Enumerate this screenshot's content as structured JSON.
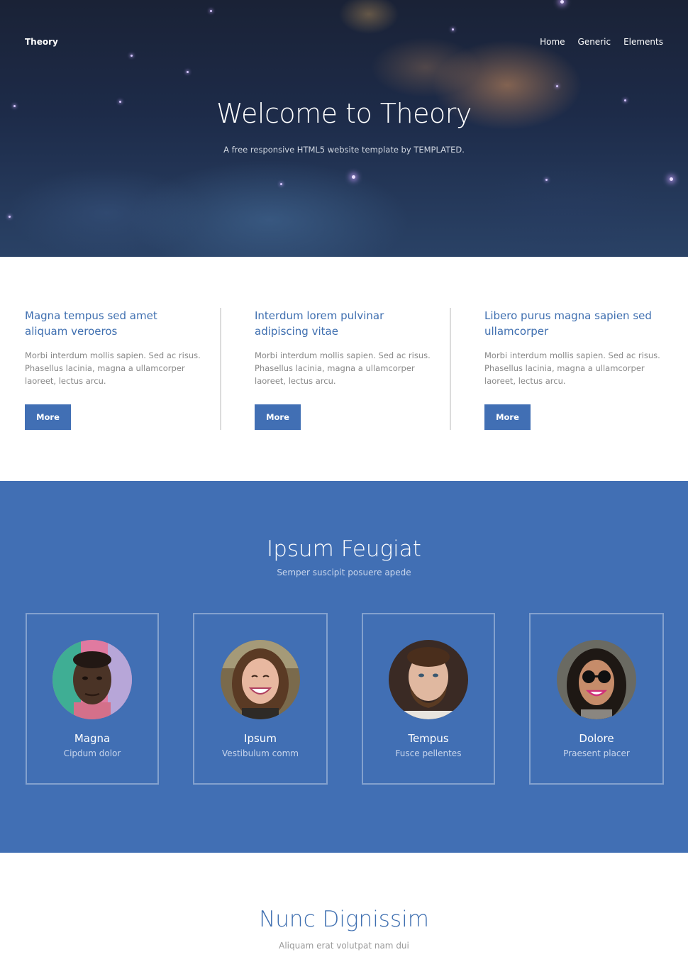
{
  "header": {
    "brand": "Theory",
    "nav": [
      {
        "label": "Home"
      },
      {
        "label": "Generic"
      },
      {
        "label": "Elements"
      }
    ]
  },
  "hero": {
    "title": "Welcome to Theory",
    "subtitle": "A free responsive HTML5 website template by TEMPLATED."
  },
  "features": [
    {
      "title": "Magna tempus sed amet aliquam veroeros",
      "text": "Morbi interdum mollis sapien. Sed ac risus. Phasellus lacinia, magna a ullamcorper laoreet, lectus arcu.",
      "button": "More"
    },
    {
      "title": "Interdum lorem pulvinar adipiscing vitae",
      "text": "Morbi interdum mollis sapien. Sed ac risus. Phasellus lacinia, magna a ullamcorper laoreet, lectus arcu.",
      "button": "More"
    },
    {
      "title": "Libero purus magna sapien sed ullamcorper",
      "text": "Morbi interdum mollis sapien. Sed ac risus. Phasellus lacinia, magna a ullamcorper laoreet, lectus arcu.",
      "button": "More"
    }
  ],
  "team": {
    "title": "Ipsum Feugiat",
    "subtitle": "Semper suscipit posuere apede",
    "members": [
      {
        "name": "Magna",
        "role": "Cipdum dolor"
      },
      {
        "name": "Ipsum",
        "role": "Vestibulum comm"
      },
      {
        "name": "Tempus",
        "role": "Fusce pellentes"
      },
      {
        "name": "Dolore",
        "role": "Praesent placer"
      }
    ]
  },
  "bottom": {
    "title": "Nunc Dignissim",
    "subtitle": "Aliquam erat volutpat nam dui"
  },
  "colors": {
    "accent": "#416fb4",
    "heading_blue": "#3f6fb0",
    "body_text": "#888888"
  }
}
